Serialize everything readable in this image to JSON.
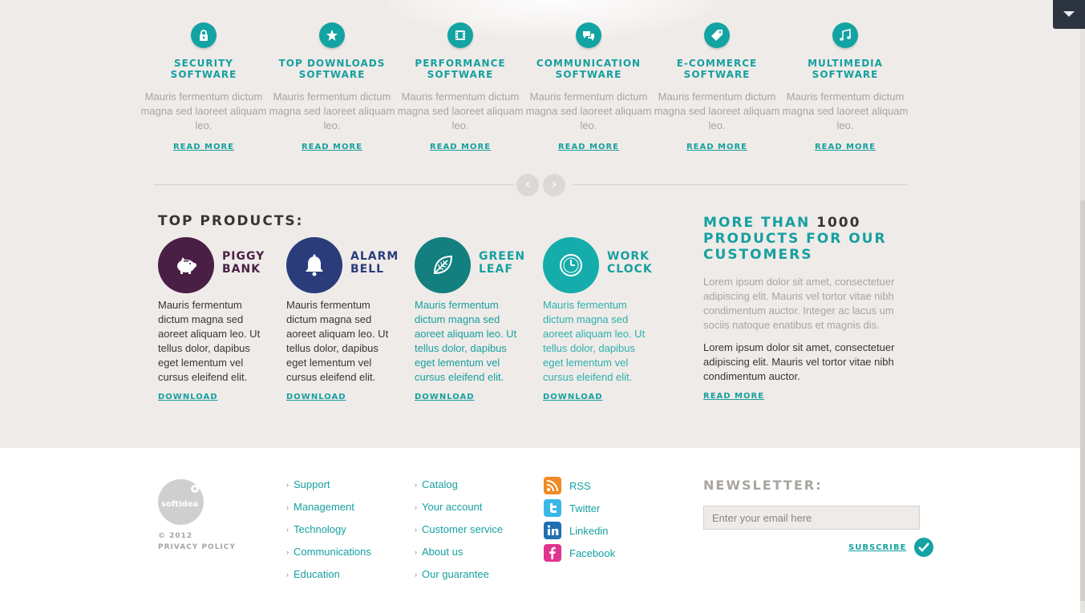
{
  "features": [
    {
      "icon": "lock-icon",
      "title_line1": "SECURITY",
      "title_line2": "SOFTWARE",
      "text": "Mauris fermentum dictum magna sed laoreet aliquam leo.",
      "link": "READ MORE"
    },
    {
      "icon": "star-icon",
      "title_line1": "TOP DOWNLOADS",
      "title_line2": "SOFTWARE",
      "text": "Mauris fermentum dictum magna sed laoreet aliquam leo.",
      "link": "READ MORE"
    },
    {
      "icon": "film-icon",
      "title_line1": "PERFORMANCE",
      "title_line2": "SOFTWARE",
      "text": "Mauris fermentum dictum magna sed laoreet aliquam leo.",
      "link": "READ MORE"
    },
    {
      "icon": "chat-icon",
      "title_line1": "COMMUNICATION",
      "title_line2": "SOFTWARE",
      "text": "Mauris fermentum dictum magna sed laoreet aliquam leo.",
      "link": "READ MORE"
    },
    {
      "icon": "tag-icon",
      "title_line1": "E-COMMERCE",
      "title_line2": "SOFTWARE",
      "text": "Mauris fermentum dictum magna sed laoreet aliquam leo.",
      "link": "READ MORE"
    },
    {
      "icon": "music-note-icon",
      "title_line1": "MULTIMEDIA",
      "title_line2": "SOFTWARE",
      "text": "Mauris fermentum dictum magna sed laoreet aliquam leo.",
      "link": "READ MORE"
    }
  ],
  "carousel": {
    "prev": "‹",
    "next": "›"
  },
  "top_products": {
    "title": "TOP PRODUCTS:",
    "items": [
      {
        "icon": "piggy-bank-icon",
        "name_line1": "PIGGY",
        "name_line2": "BANK",
        "color": "#4a1f45",
        "name_color": "#4a1f45",
        "text_color": "#3a3530",
        "text": "Mauris fermentum dictum magna sed aoreet aliquam leo. Ut tellus dolor, dapibus eget lementum vel cursus eleifend elit.",
        "link": "DOWNLOAD"
      },
      {
        "icon": "bell-icon",
        "name_line1": "ALARM",
        "name_line2": "BELL",
        "color": "#2a3c7a",
        "name_color": "#2a3c7a",
        "text_color": "#3a3530",
        "text": "Mauris fermentum dictum magna sed aoreet aliquam leo. Ut tellus dolor, dapibus eget lementum vel cursus eleifend elit.",
        "link": "DOWNLOAD"
      },
      {
        "icon": "leaf-icon",
        "name_line1": "GREEN",
        "name_line2": "LEAF",
        "color": "#13807f",
        "name_color": "#16a0a0",
        "text_color": "#16a0a0",
        "text": "Mauris fermentum dictum magna sed aoreet aliquam leo. Ut tellus dolor, dapibus eget lementum vel cursus eleifend elit.",
        "link": "DOWNLOAD"
      },
      {
        "icon": "clock-icon",
        "name_line1": "WORK",
        "name_line2": "CLOCK",
        "color": "#15adab",
        "name_color": "#16a0a0",
        "text_color": "#2cb0ae",
        "text": "Mauris fermentum dictum magna sed aoreet aliquam leo. Ut tellus dolor, dapibus eget lementum vel cursus eleifend elit.",
        "link": "DOWNLOAD"
      }
    ]
  },
  "more": {
    "title_pre": "MORE THAN ",
    "title_num": "1000",
    "title_post": "PRODUCTS FOR OUR CUSTOMERS",
    "para1": "Lorem ipsum dolor sit amet, consectetuer adipiscing elit. Mauris vel tortor vitae nibh condimentum auctor. Integer ac lacus um sociis natoque enatibus et magnis dis.",
    "para2": "Lorem ipsum dolor sit amet, consectetuer adipiscing elit. Mauris vel tortor vitae nibh condimentum auctor.",
    "link": "READ MORE"
  },
  "footer": {
    "logo_text": "softIdea",
    "copyright": "© 2012",
    "privacy": "PRIVACY POLICY",
    "links_col1": [
      "Support",
      "Management",
      "Technology",
      "Communications",
      "Education"
    ],
    "links_col2": [
      "Catalog",
      "Your account",
      "Customer service",
      "About us",
      "Our guarantee"
    ],
    "social": [
      {
        "icon": "rss-icon",
        "label": "RSS",
        "color": "#f08a24"
      },
      {
        "icon": "twitter-icon",
        "label": "Twitter",
        "color": "#3ab7e8"
      },
      {
        "icon": "linkedin-icon",
        "label": "Linkedin",
        "color": "#1f6fb2"
      },
      {
        "icon": "facebook-icon",
        "label": "Facebook",
        "color": "#e0358e"
      }
    ],
    "newsletter": {
      "title": "NEWSLETTER:",
      "placeholder": "Enter your email here",
      "subscribe": "SUBSCRIBE"
    }
  },
  "colors": {
    "accent": "#16a0a0",
    "background": "#efebe8",
    "dark_text": "#3a3530",
    "muted_text": "#a8a4a0"
  }
}
